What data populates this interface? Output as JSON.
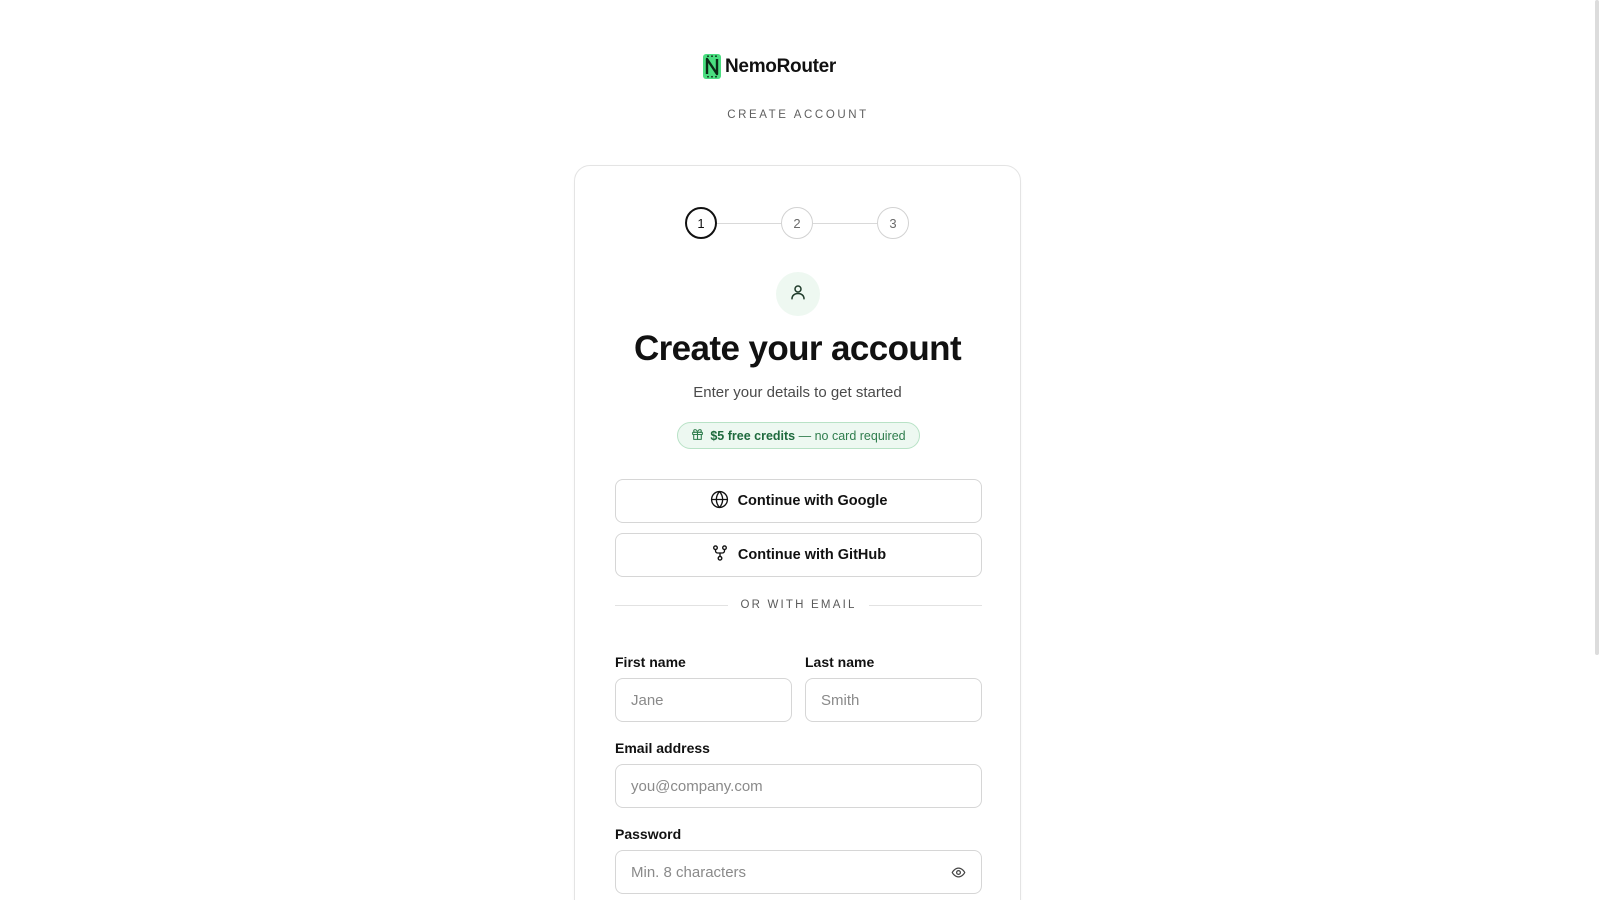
{
  "brand": {
    "name": "NemoRouter",
    "logo_letter": "N",
    "accent_color": "#4ade80"
  },
  "header": {
    "eyebrow": "CREATE ACCOUNT"
  },
  "stepper": {
    "steps": [
      "1",
      "2",
      "3"
    ],
    "active_step": 1
  },
  "card": {
    "icon": "user-icon",
    "title": "Create your account",
    "subtitle": "Enter your details to get started",
    "badge": {
      "icon": "gift-icon",
      "strong": "$5 free credits",
      "rest": "— no card required"
    },
    "oauth": {
      "google_label": "Continue with Google",
      "google_icon": "globe-icon",
      "github_label": "Continue with GitHub",
      "github_icon": "git-fork-icon"
    },
    "divider": "OR WITH EMAIL",
    "form": {
      "first_name_label": "First name",
      "first_name_placeholder": "Jane",
      "first_name_value": "",
      "last_name_label": "Last name",
      "last_name_placeholder": "Smith",
      "last_name_value": "",
      "email_label": "Email address",
      "email_placeholder": "you@company.com",
      "email_value": "",
      "password_label": "Password",
      "password_placeholder": "Min. 8 characters",
      "password_value": "",
      "password_toggle_icon": "eye-icon"
    }
  },
  "colors": {
    "badge_bg": "#edf8f1",
    "badge_border": "#b8e2c6",
    "badge_text": "#2f7d4d",
    "avatar_bg": "#eef8f1",
    "icon_green": "#1f6a3e"
  }
}
